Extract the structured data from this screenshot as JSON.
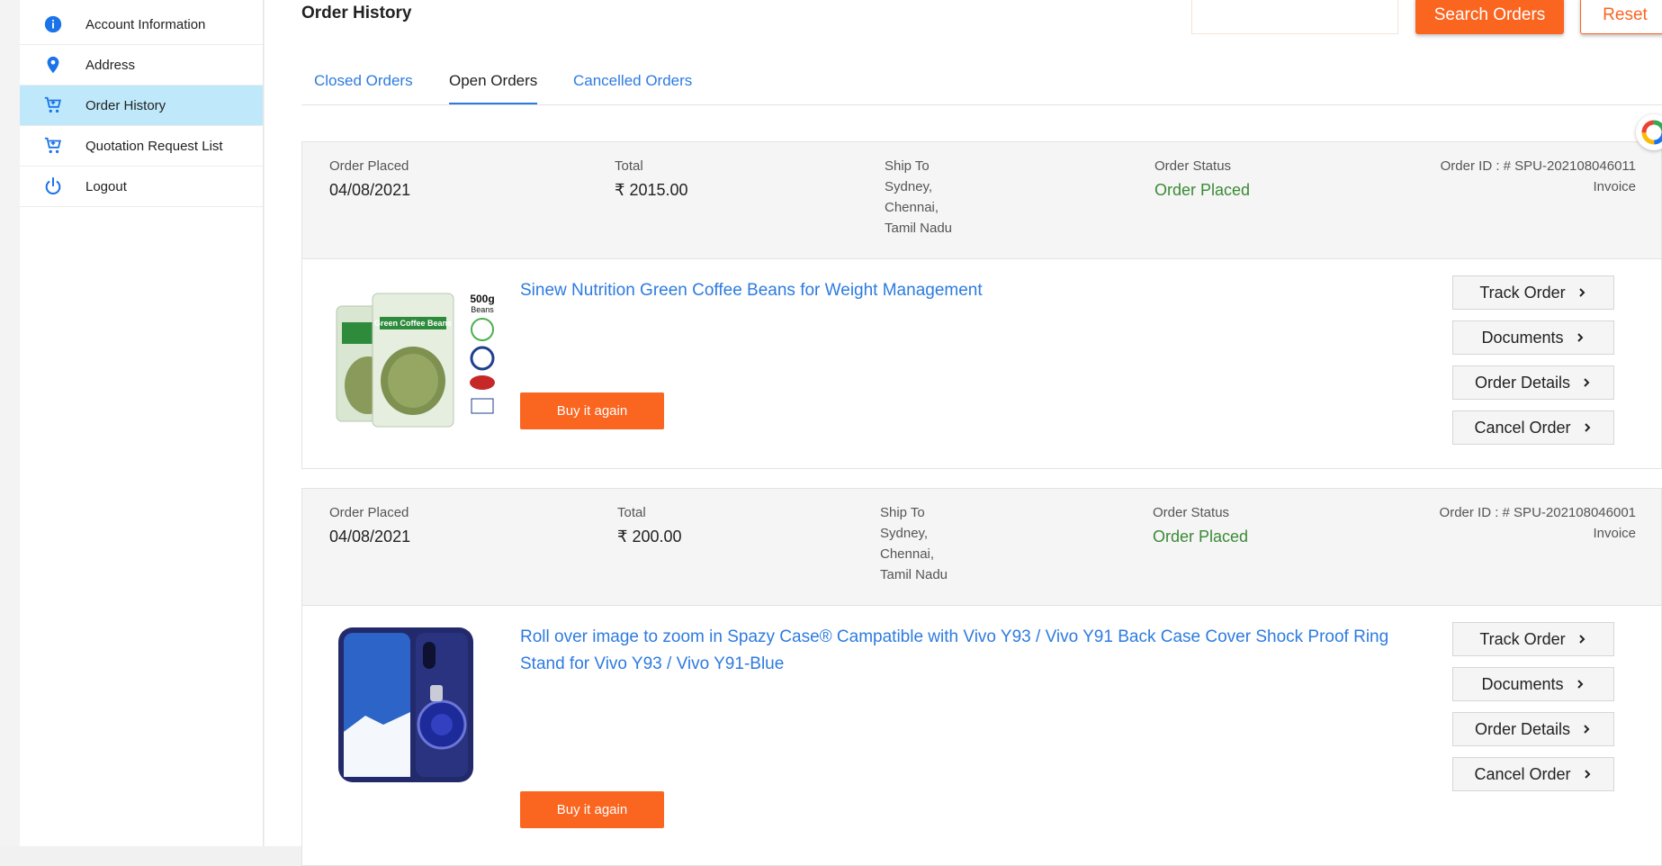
{
  "sidebar": {
    "items": [
      {
        "label": "Account Information",
        "icon": "info-icon"
      },
      {
        "label": "Address",
        "icon": "location-pin-icon"
      },
      {
        "label": "Order History",
        "icon": "cart-icon",
        "active": true
      },
      {
        "label": "Quotation Request List",
        "icon": "cart-icon"
      },
      {
        "label": "Logout",
        "icon": "power-icon"
      }
    ]
  },
  "header": {
    "title": "Order History",
    "search_placeholder": "",
    "search_button": "Search Orders",
    "reset_button": "Reset"
  },
  "tabs": [
    {
      "label": "Closed Orders"
    },
    {
      "label": "Open Orders",
      "active": true
    },
    {
      "label": "Cancelled Orders"
    }
  ],
  "labels": {
    "order_placed": "Order Placed",
    "total": "Total",
    "ship_to": "Ship To",
    "order_status": "Order Status",
    "invoice": "Invoice",
    "buy_again": "Buy it again",
    "track_order": "Track Order",
    "documents": "Documents",
    "order_details": "Order Details",
    "cancel_order": "Cancel Order"
  },
  "orders": [
    {
      "date": "04/08/2021",
      "total": "₹ 2015.00",
      "ship_to": [
        "Sydney,",
        "Chennai,",
        "Tamil Nadu"
      ],
      "status": "Order Placed",
      "order_id": "Order ID : # SPU-202108046011",
      "product_title": "Sinew Nutrition Green Coffee Beans for Weight Management",
      "image_text": [
        "500g",
        "Beans",
        "Green Coffee Beans"
      ]
    },
    {
      "date": "04/08/2021",
      "total": "₹ 200.00",
      "ship_to": [
        "Sydney,",
        "Chennai,",
        "Tamil Nadu"
      ],
      "status": "Order Placed",
      "order_id": "Order ID : # SPU-202108046001",
      "product_title": "Roll over image to zoom in Spazy Case® Campatible with Vivo Y93 / Vivo Y91 Back Case Cover Shock Proof Ring Stand for Vivo Y93 / Vivo Y91-Blue"
    }
  ],
  "colors": {
    "accent": "#fa6520",
    "link": "#2d7be0",
    "status": "#3a8a36",
    "active_side": "#bfe9fb"
  }
}
